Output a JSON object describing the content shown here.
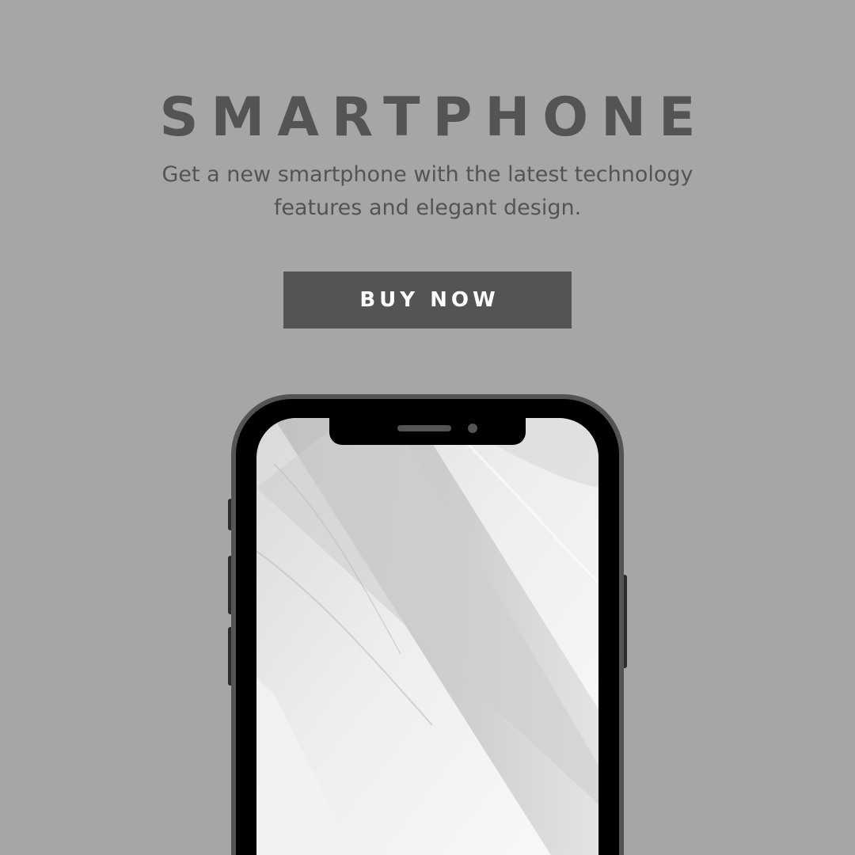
{
  "headline": "SMARTPHONE",
  "subtitle_lines": [
    "Get a new smartphone with the latest technology",
    "features and elegant design."
  ],
  "cta_label": "BUY NOW",
  "colors": {
    "background": "#a6a6a6",
    "text_dark": "#545454",
    "button_bg": "#545454",
    "button_text": "#ffffff",
    "phone_frame": "#000000",
    "phone_rim": "#545454"
  }
}
